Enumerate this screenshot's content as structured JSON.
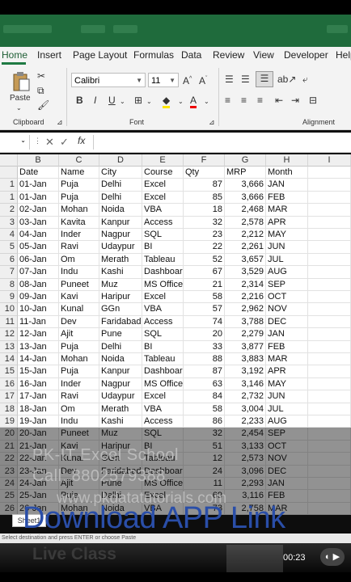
{
  "ribbon_tabs": [
    {
      "label": "Home",
      "active": true
    },
    {
      "label": "Insert"
    },
    {
      "label": "Page Layout"
    },
    {
      "label": "Formulas"
    },
    {
      "label": "Data"
    },
    {
      "label": "Review"
    },
    {
      "label": "View"
    },
    {
      "label": "Developer"
    },
    {
      "label": "Help"
    }
  ],
  "clipboard": {
    "paste_label": "Paste",
    "group_label": "Clipboard"
  },
  "font": {
    "name": "Calibri",
    "size": "11",
    "group_label": "Font",
    "bold": "B",
    "italic": "I",
    "underline": "U",
    "grow": "A^",
    "shrink": "Aˇ"
  },
  "alignment": {
    "group_label": "Alignment"
  },
  "formula_bar": {
    "fx": "fx",
    "value": ""
  },
  "columns": [
    "B",
    "C",
    "D",
    "E",
    "F",
    "G",
    "H",
    "I"
  ],
  "headers": [
    "Date",
    "Name",
    "City",
    "Course",
    "Qty",
    "MRP",
    "Month"
  ],
  "rows": [
    {
      "n": "1",
      "date": "01-Jan",
      "name": "Puja",
      "city": "Delhi",
      "course": "Excel",
      "qty": "87",
      "mrp": "3,666",
      "month": "JAN"
    },
    {
      "n": "1",
      "date": "01-Jan",
      "name": "Puja",
      "city": "Delhi",
      "course": "Excel",
      "qty": "85",
      "mrp": "3,666",
      "month": "FEB"
    },
    {
      "n": "2",
      "date": "02-Jan",
      "name": "Mohan",
      "city": "Noida",
      "course": "VBA",
      "qty": "18",
      "mrp": "2,468",
      "month": "MAR"
    },
    {
      "n": "3",
      "date": "03-Jan",
      "name": "Kavita",
      "city": "Kanpur",
      "course": "Access",
      "qty": "32",
      "mrp": "2,578",
      "month": "APR"
    },
    {
      "n": "4",
      "date": "04-Jan",
      "name": "Inder",
      "city": "Nagpur",
      "course": "SQL",
      "qty": "23",
      "mrp": "2,212",
      "month": "MAY"
    },
    {
      "n": "5",
      "date": "05-Jan",
      "name": "Ravi",
      "city": "Udaypur",
      "course": "BI",
      "qty": "22",
      "mrp": "2,261",
      "month": "JUN"
    },
    {
      "n": "6",
      "date": "06-Jan",
      "name": "Om",
      "city": "Merath",
      "course": "Tableau",
      "qty": "52",
      "mrp": "3,657",
      "month": "JUL"
    },
    {
      "n": "7",
      "date": "07-Jan",
      "name": "Indu",
      "city": "Kashi",
      "course": "Dashboarc",
      "qty": "67",
      "mrp": "3,529",
      "month": "AUG"
    },
    {
      "n": "8",
      "date": "08-Jan",
      "name": "Puneet",
      "city": "Muz",
      "course": "MS Office",
      "qty": "21",
      "mrp": "2,314",
      "month": "SEP"
    },
    {
      "n": "9",
      "date": "09-Jan",
      "name": "Kavi",
      "city": "Haripur",
      "course": "Excel",
      "qty": "58",
      "mrp": "2,216",
      "month": "OCT"
    },
    {
      "n": "10",
      "date": "10-Jan",
      "name": "Kunal",
      "city": "GGn",
      "course": "VBA",
      "qty": "57",
      "mrp": "2,962",
      "month": "NOV"
    },
    {
      "n": "11",
      "date": "11-Jan",
      "name": "Dev",
      "city": "Faridabad",
      "course": "Access",
      "qty": "74",
      "mrp": "3,788",
      "month": "DEC"
    },
    {
      "n": "12",
      "date": "12-Jan",
      "name": "Ajit",
      "city": "Pune",
      "course": "SQL",
      "qty": "20",
      "mrp": "2,279",
      "month": "JAN"
    },
    {
      "n": "13",
      "date": "13-Jan",
      "name": "Puja",
      "city": "Delhi",
      "course": "BI",
      "qty": "33",
      "mrp": "3,877",
      "month": "FEB"
    },
    {
      "n": "14",
      "date": "14-Jan",
      "name": "Mohan",
      "city": "Noida",
      "course": "Tableau",
      "qty": "88",
      "mrp": "3,883",
      "month": "MAR"
    },
    {
      "n": "15",
      "date": "15-Jan",
      "name": "Puja",
      "city": "Kanpur",
      "course": "Dashboarc",
      "qty": "87",
      "mrp": "3,192",
      "month": "APR"
    },
    {
      "n": "16",
      "date": "16-Jan",
      "name": "Inder",
      "city": "Nagpur",
      "course": "MS Office",
      "qty": "63",
      "mrp": "3,146",
      "month": "MAY"
    },
    {
      "n": "17",
      "date": "17-Jan",
      "name": "Ravi",
      "city": "Udaypur",
      "course": "Excel",
      "qty": "84",
      "mrp": "2,732",
      "month": "JUN"
    },
    {
      "n": "18",
      "date": "18-Jan",
      "name": "Om",
      "city": "Merath",
      "course": "VBA",
      "qty": "58",
      "mrp": "3,004",
      "month": "JUL"
    },
    {
      "n": "19",
      "date": "19-Jan",
      "name": "Indu",
      "city": "Kashi",
      "course": "Access",
      "qty": "86",
      "mrp": "2,233",
      "month": "AUG"
    },
    {
      "n": "20",
      "date": "20-Jan",
      "name": "Puneet",
      "city": "Muz",
      "course": "SQL",
      "qty": "32",
      "mrp": "2,454",
      "month": "SEP"
    },
    {
      "n": "21",
      "date": "21-Jan",
      "name": "Kavi",
      "city": "Haripur",
      "course": "BI",
      "qty": "51",
      "mrp": "3,133",
      "month": "OCT"
    },
    {
      "n": "22",
      "date": "22-Jan",
      "name": "Kunal",
      "city": "GGn",
      "course": "Tableau",
      "qty": "12",
      "mrp": "2,573",
      "month": "NOV"
    },
    {
      "n": "23",
      "date": "23-Jan",
      "name": "Dev",
      "city": "Faridabad",
      "course": "Dashboarc",
      "qty": "24",
      "mrp": "3,096",
      "month": "DEC"
    },
    {
      "n": "24",
      "date": "24-Jan",
      "name": "Ajit",
      "city": "Pune",
      "course": "MS Office",
      "qty": "11",
      "mrp": "2,293",
      "month": "JAN"
    },
    {
      "n": "25",
      "date": "25-Jan",
      "name": "Puja",
      "city": "Delhi",
      "course": "Excel",
      "qty": "69",
      "mrp": "3,116",
      "month": "FEB"
    },
    {
      "n": "26",
      "date": "26-Jan",
      "name": "Mohan",
      "city": "Noida",
      "course": "VBA",
      "qty": "73",
      "mrp": "2,758",
      "month": "MAR"
    }
  ],
  "watermark": {
    "line1": "PK-IT Excel School",
    "line2": "Call: 8802579388",
    "line3": "www.pkdatatutorials.com"
  },
  "sheet_tab": "Sheet1",
  "status_text": "Select destination and press ENTER or choose Paste",
  "banner": "Download APP Link",
  "live": "Live Class",
  "player": {
    "time": "00:23",
    "control": "◐ ▶"
  }
}
